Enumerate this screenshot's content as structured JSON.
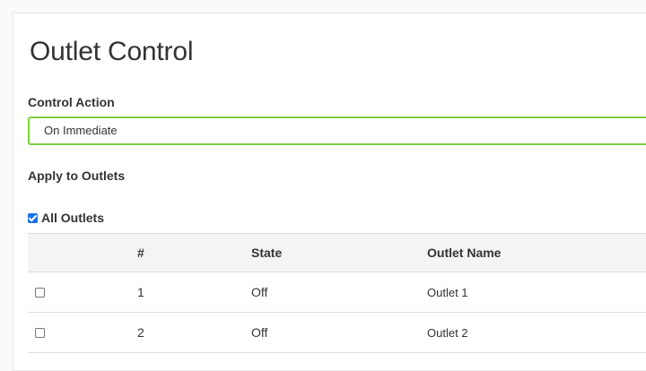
{
  "page": {
    "title": "Outlet Control"
  },
  "control_action": {
    "label": "Control Action",
    "selected": "On Immediate"
  },
  "apply": {
    "label": "Apply to Outlets",
    "all_outlets_label": "All Outlets",
    "all_outlets_checked": true
  },
  "table": {
    "headers": [
      "",
      "#",
      "State",
      "Outlet Name"
    ],
    "rows": [
      {
        "checked": false,
        "number": "1",
        "state": "Off",
        "name": "Outlet 1"
      },
      {
        "checked": false,
        "number": "2",
        "state": "Off",
        "name": "Outlet 2"
      }
    ]
  },
  "colors": {
    "focus_border": "#7bd23a",
    "checkbox_checked": "#1a73e8"
  }
}
